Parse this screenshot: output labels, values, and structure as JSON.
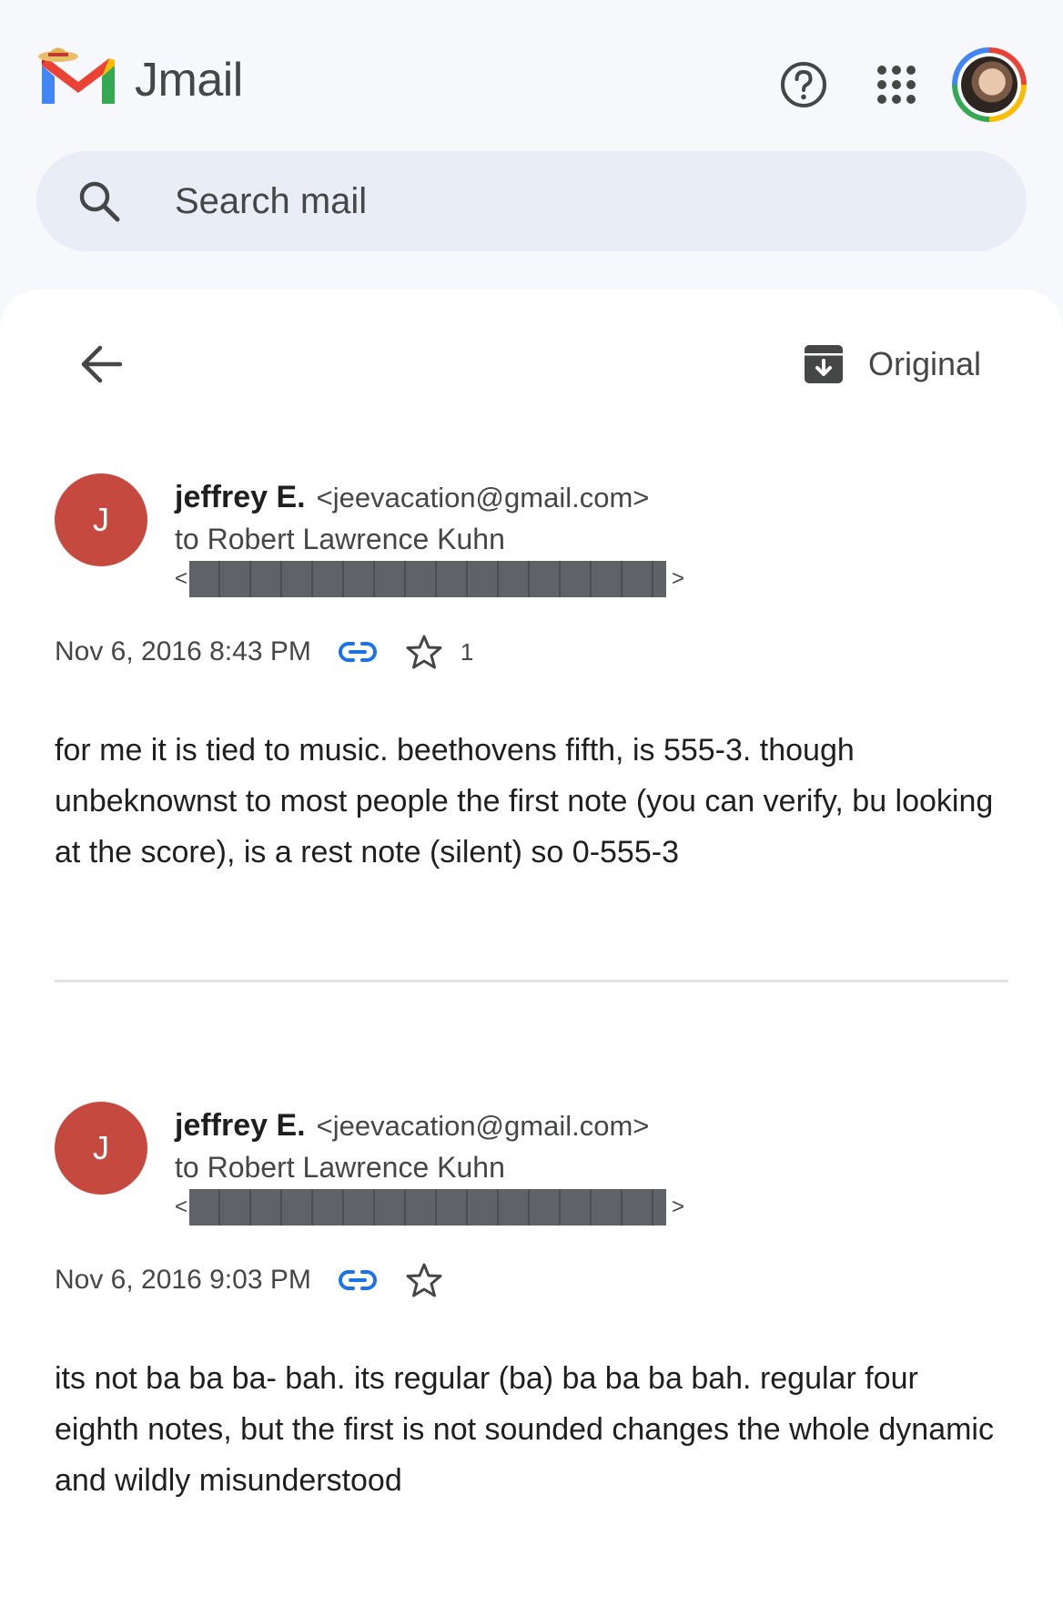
{
  "header": {
    "app_title": "Jmail",
    "icons": {
      "logo": "jmail-logo",
      "help": "help-circle-icon",
      "apps": "apps-grid-icon",
      "avatar": "account-avatar"
    }
  },
  "search": {
    "placeholder": "Search mail",
    "value": ""
  },
  "toolbar": {
    "original_label": "Original"
  },
  "messages": [
    {
      "avatar_letter": "J",
      "sender_name": "jeffrey E.",
      "sender_email": "<jeevacation@gmail.com>",
      "recipient": "to Robert Lawrence Kuhn",
      "bracket_open": "<",
      "bracket_close": ">",
      "timestamp": "Nov 6, 2016 8:43 PM",
      "star_count": "1",
      "body": "for me it is tied to music. beethovens fifth, is 555-3. though unbeknownst to most people the first note (you can verify, bu looking at the score), is a rest note (silent) so 0-555-3"
    },
    {
      "avatar_letter": "J",
      "sender_name": "jeffrey E.",
      "sender_email": "<jeevacation@gmail.com>",
      "recipient": "to Robert Lawrence Kuhn",
      "bracket_open": "<",
      "bracket_close": ">",
      "timestamp": "Nov 6, 2016 9:03 PM",
      "star_count": "",
      "body": "its not ba ba ba- bah. its regular (ba) ba ba ba bah. regular four eighth notes, but the first is not sounded changes the whole dynamic and wildly misunderstood"
    }
  ],
  "colors": {
    "avatar_bg": "#c5493f",
    "link_icon": "#1a73e8",
    "page_bg": "#f6f8fc",
    "search_bg": "#e9eef6",
    "redaction": "#5f6368"
  }
}
